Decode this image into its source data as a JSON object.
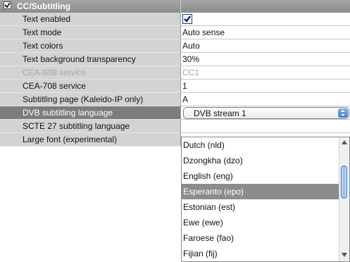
{
  "section": {
    "title": "CC/Subtitling",
    "checked": true
  },
  "rows": [
    {
      "label": "Text enabled",
      "value": "",
      "type": "checkbox",
      "checked": true
    },
    {
      "label": "Text mode",
      "value": "Auto sense"
    },
    {
      "label": "Text colors",
      "value": "Auto"
    },
    {
      "label": "Text background transparency",
      "value": "30%"
    },
    {
      "label": "CEA-608 service",
      "value": "CC1",
      "disabled": true
    },
    {
      "label": "CEA-708 service",
      "value": "1"
    },
    {
      "label": "Subtitling page (Kaleido-IP only)",
      "value": "A"
    },
    {
      "label": "DVB subtitling language",
      "value": "DVB stream 1",
      "type": "combo",
      "selected": true
    },
    {
      "label": "SCTE 27 subtitling language",
      "value": ""
    },
    {
      "label": "Large font (experimental)",
      "value": ""
    }
  ],
  "dropdown": {
    "items": [
      "Dutch (nld)",
      "Dzongkha (dzo)",
      "English (eng)",
      "Esperanto (epo)",
      "Estonian (est)",
      "Ewe (ewe)",
      "Faroese (fao)",
      "Fijian (fij)"
    ],
    "highlighted_index": 3
  },
  "colors": {
    "header": "#8c8c8c",
    "label_bg": "#d3d3d3",
    "selected_bg": "#7d7d7d",
    "accent": "#3a7bd5"
  }
}
